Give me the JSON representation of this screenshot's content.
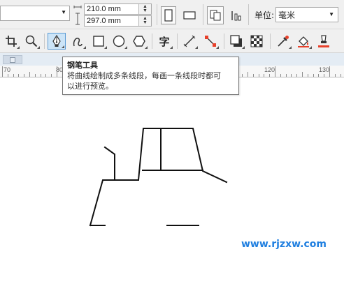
{
  "property_bar": {
    "width_value": "210.0 mm",
    "height_value": "297.0 mm",
    "unit_label": "单位:",
    "unit_value": "毫米",
    "spin_up": "▲",
    "spin_down": "▼",
    "dropdown_arrow": "▼"
  },
  "toolbox": {
    "text_tool_glyph": "字",
    "icons": [
      "crop-icon",
      "zoom-icon",
      "pen-icon",
      "curve-icon",
      "rectangle-icon",
      "ellipse-icon",
      "polygon-icon",
      "text-icon",
      "line-icon",
      "connector-icon",
      "drop-shadow-icon",
      "transparency-icon",
      "eyedropper-icon",
      "fill-icon",
      "outline-fill-icon"
    ]
  },
  "ruler": {
    "labels": [
      "70",
      "80",
      "120",
      "130"
    ]
  },
  "tooltip": {
    "title": "钢笔工具",
    "line1": "将曲线绘制成多条线段，每画一条线段时都可",
    "line2": "以进行预览。"
  },
  "watermark": {
    "text": "www.rjzxw.com"
  },
  "colors": {
    "toolbar_bg": "#f0f0f0",
    "ruler_strip": "#e4ecf4",
    "watermark": "#1f7fe0",
    "pen_highlight": "#cce4f7"
  }
}
